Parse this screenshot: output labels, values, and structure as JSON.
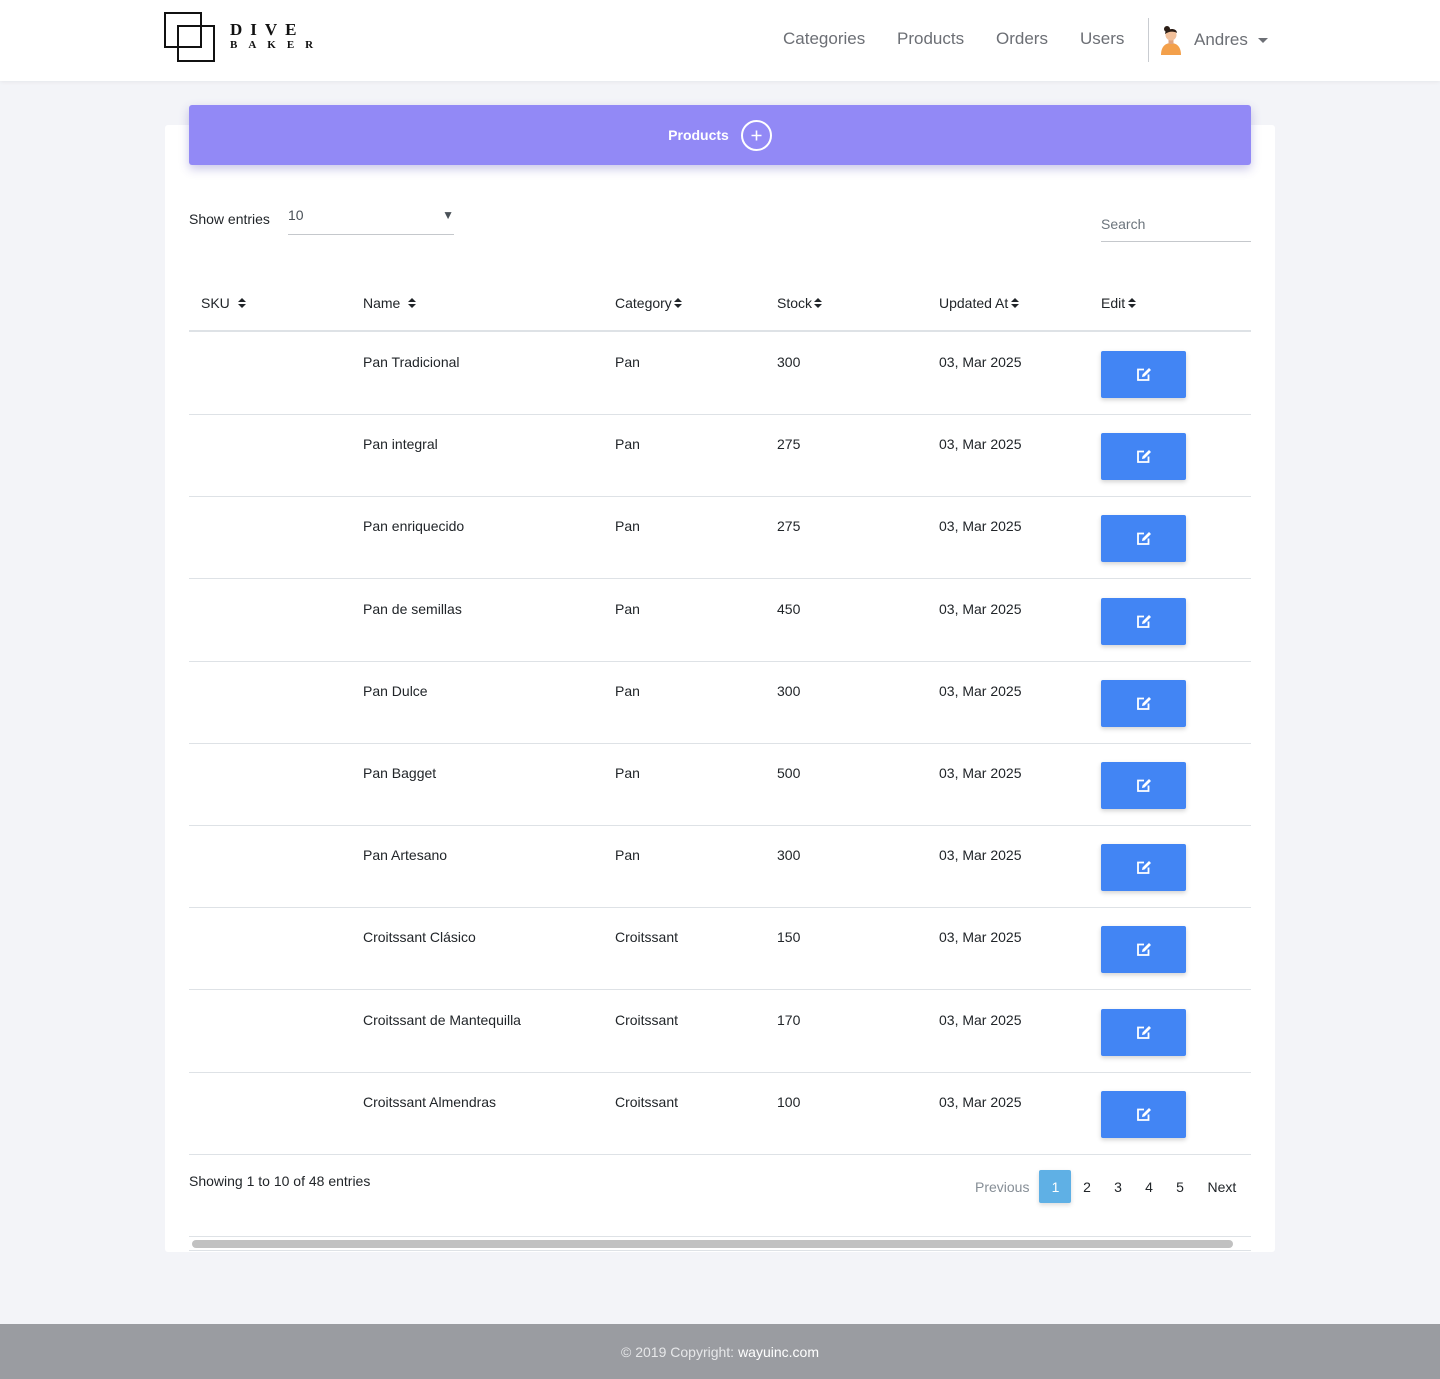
{
  "brand": {
    "line1": "DIVE",
    "line2": "BAKER"
  },
  "nav": {
    "links": [
      "Categories",
      "Products",
      "Orders",
      "Users"
    ],
    "user_name": "Andres"
  },
  "card": {
    "title": "Products",
    "add_icon": "plus-icon",
    "show_entries_label": "Show entries",
    "entries_value": "10",
    "search_placeholder": "Search"
  },
  "table": {
    "columns": [
      "SKU",
      "Name",
      "Category",
      "Stock",
      "Updated At",
      "Edit"
    ],
    "rows": [
      {
        "sku": "",
        "name": "Pan Tradicional",
        "category": "Pan",
        "stock": "300",
        "updated": "03, Mar 2025"
      },
      {
        "sku": "",
        "name": "Pan integral",
        "category": "Pan",
        "stock": "275",
        "updated": "03, Mar 2025"
      },
      {
        "sku": "",
        "name": "Pan enriquecido",
        "category": "Pan",
        "stock": "275",
        "updated": "03, Mar 2025"
      },
      {
        "sku": "",
        "name": "Pan de semillas",
        "category": "Pan",
        "stock": "450",
        "updated": "03, Mar 2025"
      },
      {
        "sku": "",
        "name": "Pan Dulce",
        "category": "Pan",
        "stock": "300",
        "updated": "03, Mar 2025"
      },
      {
        "sku": "",
        "name": "Pan Bagget",
        "category": "Pan",
        "stock": "500",
        "updated": "03, Mar 2025"
      },
      {
        "sku": "",
        "name": "Pan Artesano",
        "category": "Pan",
        "stock": "300",
        "updated": "03, Mar 2025"
      },
      {
        "sku": "",
        "name": "Croitssant Clásico",
        "category": "Croitssant",
        "stock": "150",
        "updated": "03, Mar 2025"
      },
      {
        "sku": "",
        "name": "Croitssant de Mantequilla",
        "category": "Croitssant",
        "stock": "170",
        "updated": "03, Mar 2025"
      },
      {
        "sku": "",
        "name": "Croitssant Almendras",
        "category": "Croitssant",
        "stock": "100",
        "updated": "03, Mar 2025"
      }
    ],
    "edit_icon": "edit-icon"
  },
  "pagination": {
    "info": "Showing 1 to 10 of 48 entries",
    "previous": "Previous",
    "pages": [
      "1",
      "2",
      "3",
      "4",
      "5"
    ],
    "active_page": "1",
    "next": "Next"
  },
  "footer": {
    "copyright": "© 2019 Copyright:",
    "link": "wayuinc.com"
  },
  "colors": {
    "header_bg": "#9289f6",
    "edit_button": "#4285f4",
    "active_page": "#5fb0e5",
    "footer_bg": "#9a9ca1"
  }
}
